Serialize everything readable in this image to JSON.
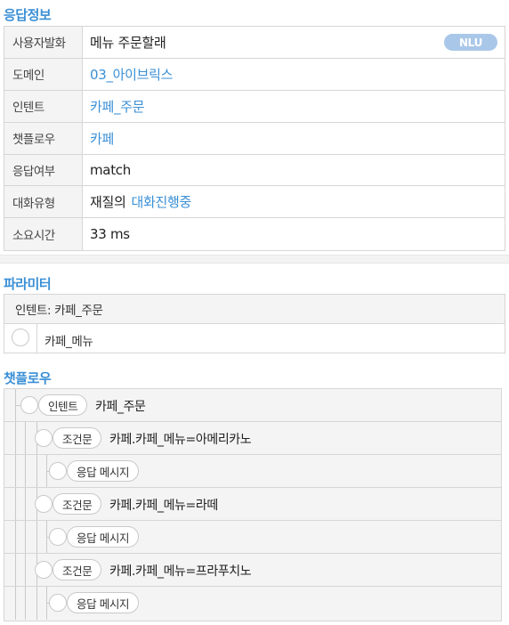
{
  "response_info": {
    "title": "응답정보",
    "nlu_badge": "NLU",
    "rows": [
      {
        "label": "사용자발화",
        "value": "메뉴 주문할래"
      },
      {
        "label": "도메인",
        "value": "03_아이브릭스"
      },
      {
        "label": "인텐트",
        "value": "카페_주문"
      },
      {
        "label": "챗플로우",
        "value": "카페"
      },
      {
        "label": "응답여부",
        "value": "match"
      },
      {
        "label": "대화유형",
        "value_prefix": "재질의",
        "value_link": "대화진행중"
      },
      {
        "label": "소요시간",
        "value": "33 ms"
      }
    ]
  },
  "parameters": {
    "title": "파라미터",
    "header": "인텐트: 카페_주문",
    "items": [
      "카페_메뉴"
    ]
  },
  "chatflow": {
    "title": "챗플로우",
    "nodes": [
      {
        "tag": "인텐트",
        "text": "카페_주문"
      },
      {
        "tag": "조건문",
        "text": "카페.카페_메뉴=아메리카노"
      },
      {
        "tag": "응답 메시지",
        "text": ""
      },
      {
        "tag": "조건문",
        "text": "카페.카페_메뉴=라떼"
      },
      {
        "tag": "응답 메시지",
        "text": ""
      },
      {
        "tag": "조건문",
        "text": "카페.카페_메뉴=프라푸치노"
      },
      {
        "tag": "응답 메시지",
        "text": ""
      }
    ]
  },
  "colors": {
    "accent": "#3a8fd6",
    "badge": "#a9c7e8"
  }
}
